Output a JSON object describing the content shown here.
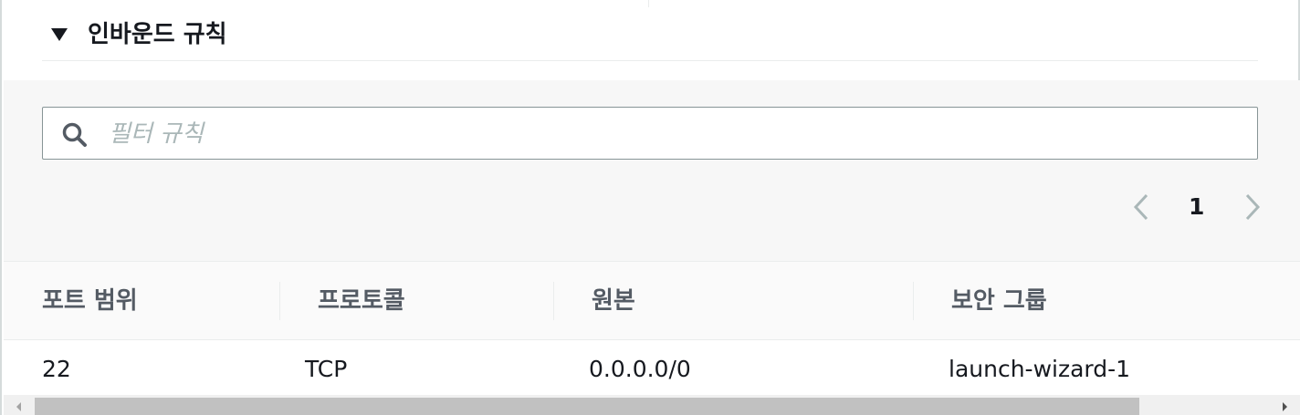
{
  "section": {
    "title": "인바운드 규칙"
  },
  "search": {
    "placeholder": "필터 규칙",
    "value": ""
  },
  "pagination": {
    "current_page": "1"
  },
  "table": {
    "columns": [
      "포트 범위",
      "프로토콜",
      "원본",
      "보안 그룹"
    ],
    "rows": [
      [
        "22",
        "TCP",
        "0.0.0.0/0",
        "launch-wizard-1"
      ]
    ]
  },
  "icons": {
    "section_toggle": "caret-down-icon",
    "search": "search-icon",
    "prev": "chevron-left-icon",
    "next": "chevron-right-icon"
  },
  "colors": {
    "text": "#16191f",
    "header_text": "#545b64",
    "placeholder": "#aab7b8",
    "panel_bg": "#f7f7f7",
    "disabled_chevron": "#aab7b8"
  }
}
